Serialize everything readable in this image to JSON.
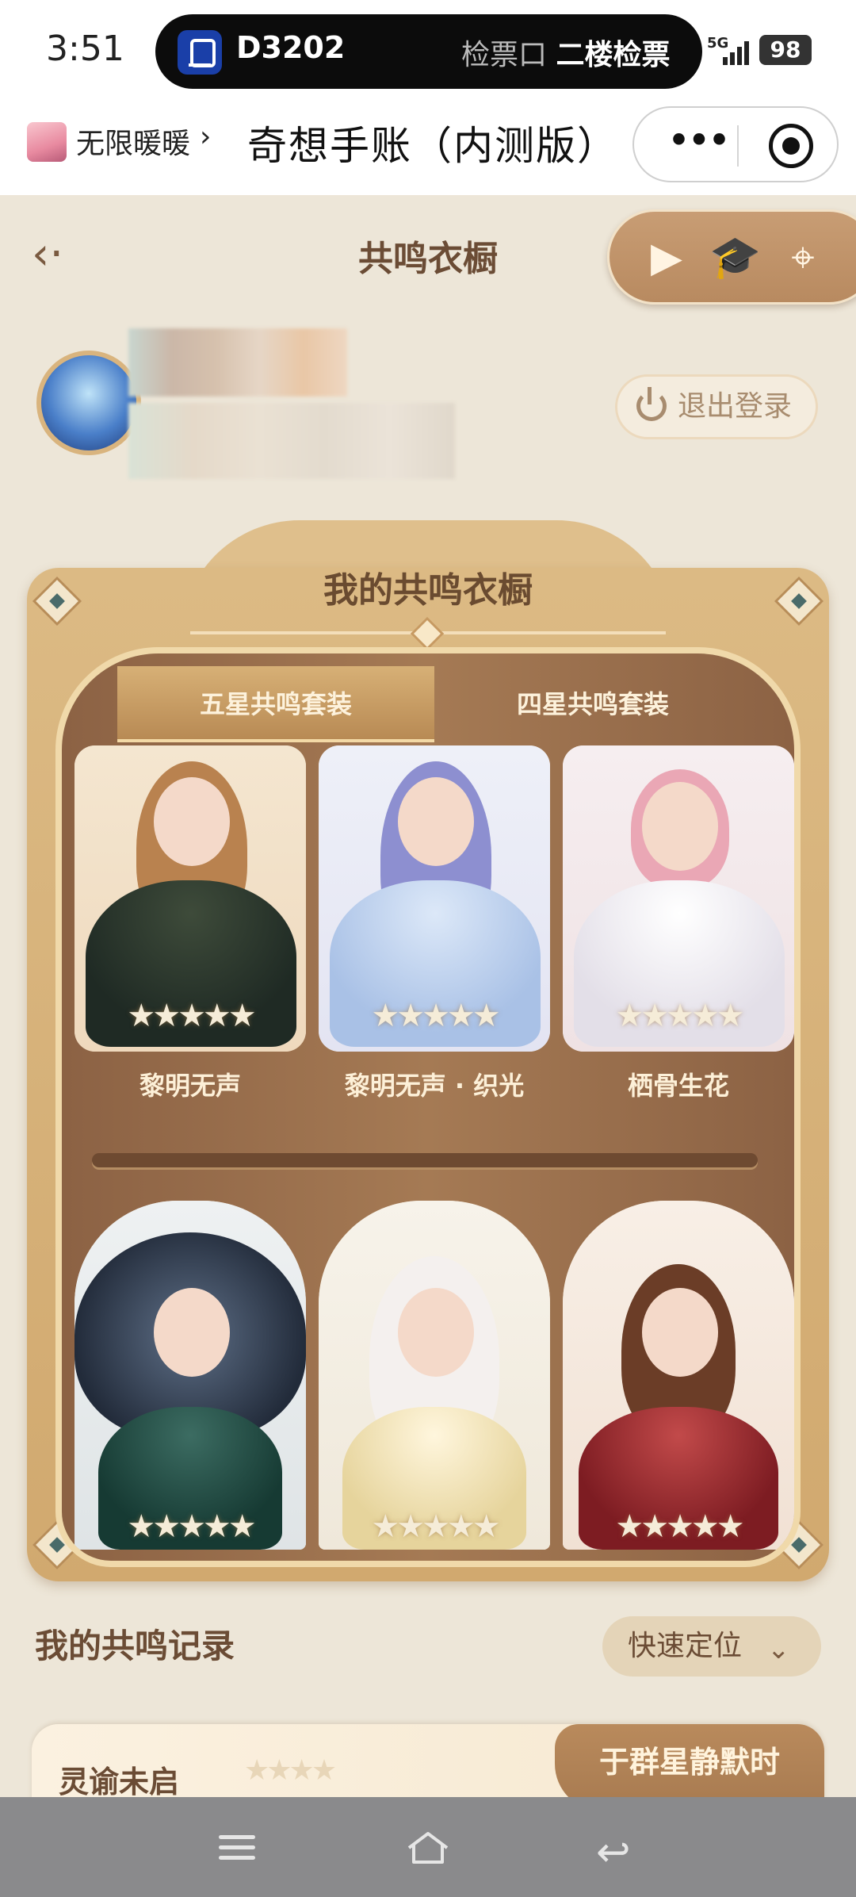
{
  "status_bar": {
    "time": "3:51",
    "train_number": "D3202",
    "gate_prefix": "检票口",
    "gate_detail": "二楼检票",
    "network": "5G",
    "battery": "98"
  },
  "nav": {
    "app_name": "无限暖暖",
    "chevron": "›",
    "title": "奇想手账（内测版）",
    "more_icon": "more-dots-icon",
    "close_icon": "target-icon"
  },
  "header": {
    "back_icon": "back-arrow-icon",
    "title": "共鸣衣橱",
    "toolbox_icons": [
      "play-arrow-icon",
      "tutor-icon",
      "map-icon"
    ]
  },
  "profile": {
    "logout_label": "退出登录"
  },
  "wardrobe": {
    "title": "我的共鸣衣橱",
    "tabs": [
      {
        "label": "五星共鸣套装",
        "active": true
      },
      {
        "label": "四星共鸣套装",
        "active": false
      }
    ],
    "row1": [
      {
        "name": "黎明无声",
        "stars": "★★★★★"
      },
      {
        "name": "黎明无声 · 织光",
        "stars": "★★★★★"
      },
      {
        "name": "栖骨生花",
        "stars": "★★★★★"
      }
    ],
    "row2": [
      {
        "stars": "★★★★★"
      },
      {
        "stars": "★★★★★"
      },
      {
        "stars": "★★★★★"
      }
    ]
  },
  "records": {
    "title": "我的共鸣记录",
    "locate_label": "快速定位",
    "first_item": {
      "name": "灵谕未启",
      "stars": "★★★★",
      "tab": "于群星静默时"
    }
  },
  "colors": {
    "accent_brown": "#6b4c35",
    "panel_gold": "#d6b07a",
    "wood": "#9a6e4b"
  }
}
